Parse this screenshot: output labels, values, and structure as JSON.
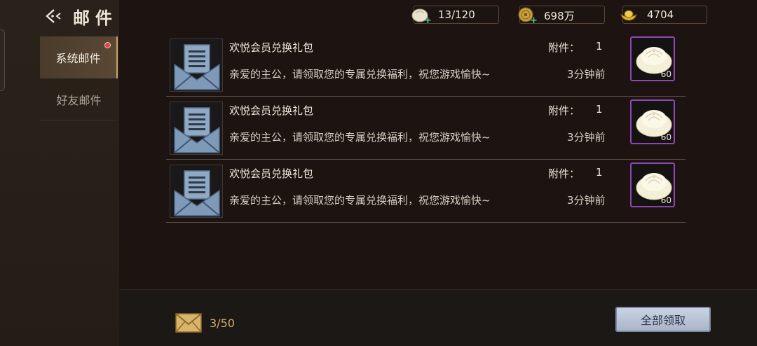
{
  "header": {
    "title": "邮件"
  },
  "sidebar": {
    "tabs": [
      {
        "label": "系统邮件",
        "active": true,
        "has_badge": true
      },
      {
        "label": "好友邮件",
        "active": false,
        "has_badge": false
      }
    ]
  },
  "resources": [
    {
      "icon": "bun-icon",
      "value": "13/120"
    },
    {
      "icon": "copper-coin-icon",
      "value": "698万"
    },
    {
      "icon": "gold-ingot-icon",
      "value": "4704"
    }
  ],
  "mails": [
    {
      "subject": "欢悦会员兑换礼包",
      "body": "亲爱的主公，请领取您的专属兑换福利，祝您游戏愉快~",
      "attachment_label": "附件：",
      "attachment_count": "1",
      "time": "3分钟前",
      "item_icon": "steamed-bun-icon",
      "item_qty": "60"
    },
    {
      "subject": "欢悦会员兑换礼包",
      "body": "亲爱的主公，请领取您的专属兑换福利，祝您游戏愉快~",
      "attachment_label": "附件：",
      "attachment_count": "1",
      "time": "3分钟前",
      "item_icon": "steamed-bun-icon",
      "item_qty": "60"
    },
    {
      "subject": "欢悦会员兑换礼包",
      "body": "亲爱的主公，请领取您的专属兑换福利，祝您游戏愉快~",
      "attachment_label": "附件：",
      "attachment_count": "1",
      "time": "3分钟前",
      "item_icon": "steamed-bun-icon",
      "item_qty": "60"
    }
  ],
  "footer": {
    "mail_count": "3/50",
    "claim_all_label": "全部领取"
  },
  "colors": {
    "accent_gold": "#c9a26b",
    "item_rarity_purple": "#8d47b5",
    "badge_red": "#e64040",
    "button_blue": "#a9b6c9"
  }
}
